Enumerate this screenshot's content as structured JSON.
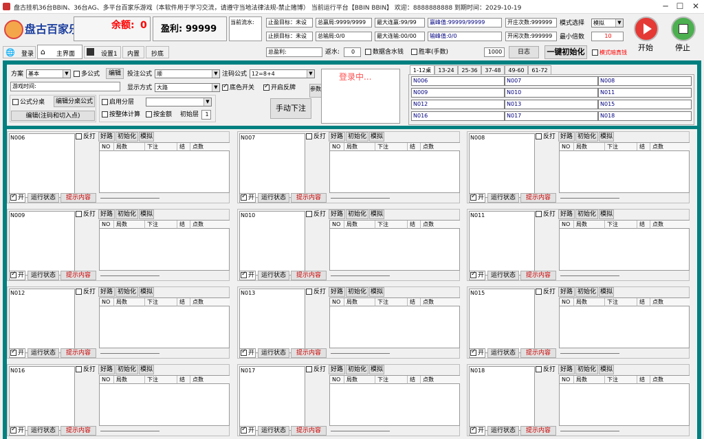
{
  "window": {
    "title": "盘古挂机36台BBIN、36台AG、多平台百家乐游戏（本软件用于学习交流，请遵守当地法律法规-禁止赌博） 当前运行平台【BBIN BBIN】 欢迎：8888888888 到期时间：2029-10-19"
  },
  "header": {
    "logo_text": "盘古百家乐",
    "balance_label": "余额:",
    "balance_value": "0",
    "profit_label": "盈利:",
    "profit_value": "99999",
    "current_flow_label": "当前流水:",
    "stop_win_label": "止盈目标：未设",
    "stop_loss_label": "止损目标：未设",
    "total_win_label": "总赢局:9999/9999",
    "total_loss_label": "总输局:0/0",
    "max_win_streak": "最大连赢:99/99",
    "max_loss_streak": "最大连输:00/00",
    "win_peak": "赢峰值:99999/99999",
    "loss_peak": "输峰值:0/0",
    "open_banker": "开庄次数:999999",
    "open_player": "开闲次数:999999",
    "mode_label": "模式选择",
    "mode_value": "模拟",
    "min_multiple_label": "最小倍数",
    "min_multiple_value": "10",
    "start_label": "开始",
    "stop_label": "停止",
    "total_profit_label": "总盈利:",
    "rebate_label": "返水:",
    "rebate_value": "0",
    "data_water_label": "数据含水钱",
    "win_rate_label": "胜率(手数)",
    "win_rate_value": "1000",
    "log_button": "日志",
    "init_button": "一键初始化",
    "formal_dark_label": "模式暗真钱"
  },
  "tabs": [
    {
      "label": "登录"
    },
    {
      "label": "主界面"
    },
    {
      "label": "设置1"
    },
    {
      "label": "内置"
    },
    {
      "label": "抄底"
    }
  ],
  "config": {
    "scheme_label": "方案",
    "scheme_value": "基本",
    "multi_formula": "多公式",
    "edit_button": "编辑",
    "bet_formula_label": "投注公式",
    "bet_formula_value": "顺",
    "code_formula_label": "注码公式",
    "code_formula_value": "12=8+4",
    "game_time_label": "游戏时间:",
    "display_mode_label": "显示方式",
    "display_mode_value": "大路",
    "bg_color_switch": "底色开关",
    "open_feedback": "开启反牌",
    "params_button": "参数",
    "formula_split": "公式分桌",
    "edit_split_formula": "编辑分桌公式",
    "enable_layer": "启用分层",
    "edit_code_entry": "编辑(注码和切入点)",
    "total_calc": "按整体计算",
    "by_amount": "按金额",
    "init_layer_label": "初始层",
    "init_layer_value": "1",
    "manual_bet": "手动下注",
    "login_status": "登录中..."
  },
  "table_tabs": [
    "1-12桌",
    "13-24",
    "25-36",
    "37-48",
    "49-60",
    "61-72"
  ],
  "table_ids": [
    "N006",
    "N007",
    "N008",
    "N009",
    "N010",
    "N011",
    "N012",
    "N013",
    "N015",
    "N016",
    "N017",
    "N018"
  ],
  "card_labels": {
    "reverse": "反打",
    "good_road": "好路",
    "init": "初始化",
    "simulate": "模拟",
    "col_no": "NO",
    "col_round": "局数",
    "col_bet": "下注",
    "col_result": "结",
    "col_points": "点数",
    "on": "开",
    "run_status": "运行状态",
    "hint": "提示内容"
  },
  "colors": {
    "teal": "#008080",
    "red": "#ff0000",
    "navy": "#000080"
  }
}
